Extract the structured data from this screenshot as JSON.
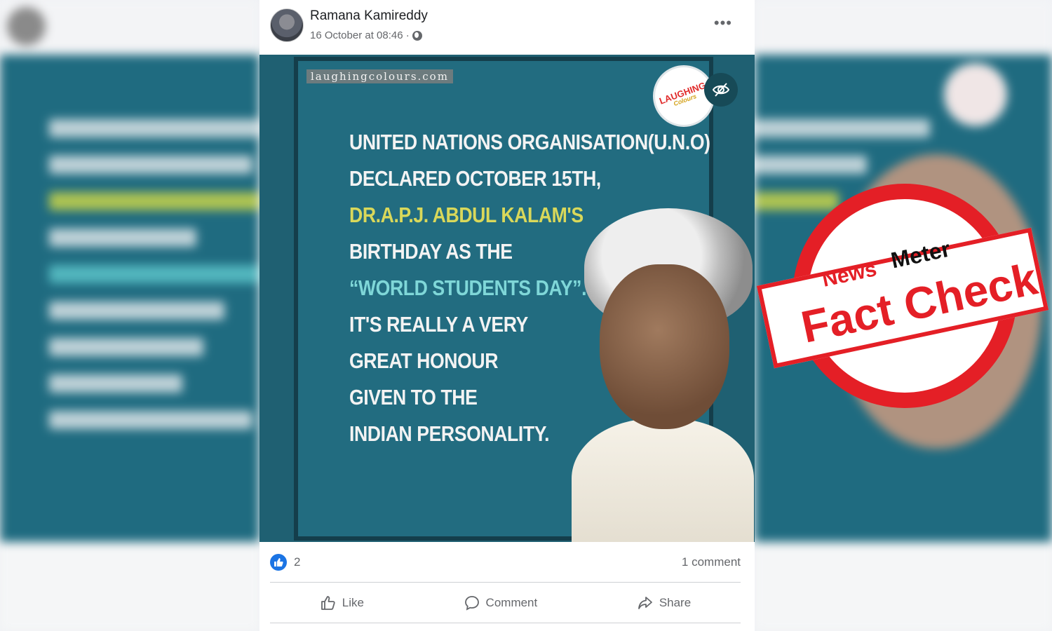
{
  "post": {
    "author": "Ramana Kamireddy",
    "timestamp": "16 October at 08:46 ·",
    "privacy_icon": "globe-icon",
    "more_label": "•••"
  },
  "image": {
    "site_label": "laughingcolours.com",
    "logo_text": "LAUGHING",
    "logo_sub": "Colours",
    "lines": [
      "United Nations Organisation(U.N.O)",
      "declared October 15th,",
      "Dr.A.P.J. Abdul Kalam's",
      "birthday as the",
      "“World Students Day”.",
      "It's really a very",
      "great honour",
      "given to the",
      "Indian personality."
    ]
  },
  "reactions": {
    "like_count": "2",
    "comment_count": "1 comment"
  },
  "actions": {
    "like": "Like",
    "comment": "Comment",
    "share": "Share"
  },
  "stamp": {
    "news": "News",
    "meter": "Meter",
    "fact_check": "Fact Check"
  },
  "colors": {
    "teal_bg": "#226c80",
    "stamp_red": "#e41f26",
    "like_blue": "#1b74e4"
  }
}
